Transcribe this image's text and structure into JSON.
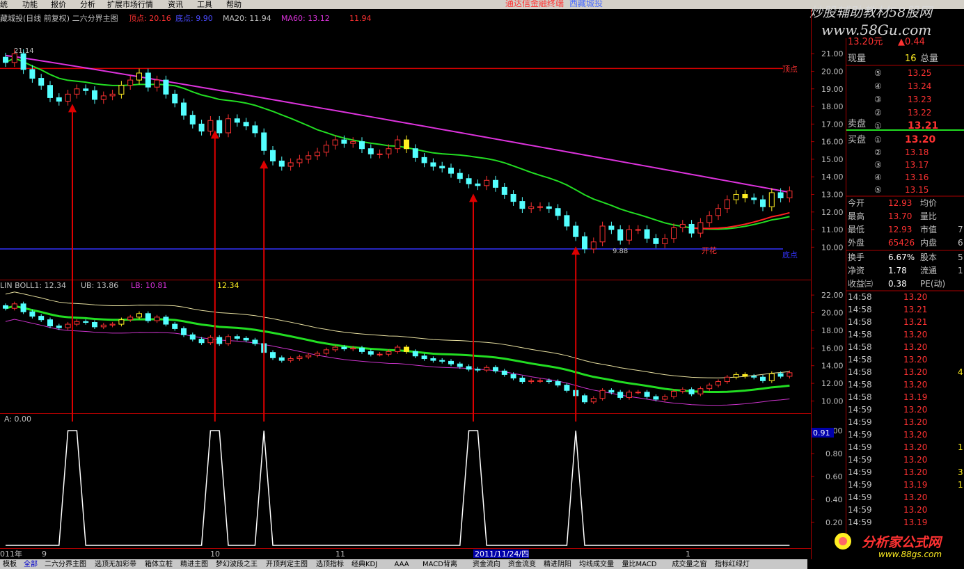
{
  "menu": [
    "统",
    "功能",
    "报价",
    "分析",
    "扩展市场行情",
    "资讯",
    "工具",
    "帮助"
  ],
  "header_center": {
    "text1": "通达信金融终端",
    "text2": "西藏城投"
  },
  "watermark": {
    "line1": "炒股辅助教材58股网",
    "line2": "www.58Gu.com",
    "bottom1": "分析家公式网",
    "bottom2": "www.88gs.com"
  },
  "main_legend": {
    "name": "藏城投(日线 前复权) 二六分界主图",
    "top_label": "顶点: 20.16",
    "bottom_label": "底点: 9.90",
    "ma20": "MA20: 11.94",
    "ma60": "MA60: 13.12",
    "extra": "11.94"
  },
  "main_chart_labels": {
    "top": "顶点",
    "bottom": "底点",
    "open_flower": "开花",
    "high_note": "21.14",
    "low_note": "9.88"
  },
  "boll_legend": {
    "name": "LIN BOLL1: 12.34",
    "ub": "UB: 13.86",
    "lb": "LB: 10.81",
    "extra": "12.34"
  },
  "ind_legend": {
    "a": "A: 0.00"
  },
  "price_axis": [
    "21.00",
    "20.00",
    "19.00",
    "18.00",
    "17.00",
    "16.00",
    "15.00",
    "14.00",
    "13.00",
    "12.00",
    "11.00",
    "10.00"
  ],
  "boll_axis": [
    "22.00",
    "20.00",
    "18.00",
    "16.00",
    "14.00",
    "12.00",
    "10.00"
  ],
  "ind_axis": [
    "1.00",
    "0.80",
    "0.60",
    "0.40",
    "0.20"
  ],
  "ind_current": "0.91",
  "date_axis": {
    "y2011": "011年",
    "m9": "9",
    "m10": "10",
    "m11": "11",
    "m12": "1",
    "cursor": "2011/11/24/四"
  },
  "quote": {
    "last": "13.20元",
    "change": "▲0.44",
    "now_vol_label": "现量",
    "now_vol": "16",
    "total_label": "总量",
    "sell": [
      {
        "n": "⑤",
        "p": "13.25"
      },
      {
        "n": "④",
        "p": "13.24"
      },
      {
        "n": "③",
        "p": "13.23"
      },
      {
        "n": "②",
        "p": "13.22"
      },
      {
        "n": "①",
        "p": "13.21"
      }
    ],
    "sell_label": "卖盘",
    "buy_label": "买盘",
    "buy": [
      {
        "n": "①",
        "p": "13.20"
      },
      {
        "n": "②",
        "p": "13.18"
      },
      {
        "n": "③",
        "p": "13.17"
      },
      {
        "n": "④",
        "p": "13.16"
      },
      {
        "n": "⑤",
        "p": "13.15"
      }
    ],
    "stats": [
      {
        "l1": "今开",
        "v1": "12.93",
        "l2": "均价",
        "v2": ""
      },
      {
        "l1": "最高",
        "v1": "13.70",
        "l2": "量比",
        "v2": ""
      },
      {
        "l1": "最低",
        "v1": "12.93",
        "l2": "市值",
        "v2": "7"
      },
      {
        "l1": "外盘",
        "v1": "65426",
        "l2": "内盘",
        "v2": "6"
      }
    ],
    "stats2": [
      {
        "l1": "换手",
        "v1": "6.67%",
        "l2": "股本",
        "v2": "5"
      },
      {
        "l1": "净资",
        "v1": "1.78",
        "l2": "流通",
        "v2": "1"
      },
      {
        "l1": "收益㈢",
        "v1": "0.38",
        "l2": "PE(动)",
        "v2": ""
      }
    ]
  },
  "ticks": [
    {
      "t": "14:58",
      "p": "13.20",
      "v": ""
    },
    {
      "t": "14:58",
      "p": "13.21",
      "v": ""
    },
    {
      "t": "14:58",
      "p": "13.21",
      "v": ""
    },
    {
      "t": "14:58",
      "p": "13.20",
      "v": ""
    },
    {
      "t": "14:58",
      "p": "13.20",
      "v": ""
    },
    {
      "t": "14:58",
      "p": "13.20",
      "v": ""
    },
    {
      "t": "14:58",
      "p": "13.20",
      "v": "4"
    },
    {
      "t": "14:58",
      "p": "13.20",
      "v": ""
    },
    {
      "t": "14:58",
      "p": "13.19",
      "v": ""
    },
    {
      "t": "14:59",
      "p": "13.20",
      "v": ""
    },
    {
      "t": "14:59",
      "p": "13.20",
      "v": ""
    },
    {
      "t": "14:59",
      "p": "13.20",
      "v": ""
    },
    {
      "t": "14:59",
      "p": "13.20",
      "v": "1"
    },
    {
      "t": "14:59",
      "p": "13.20",
      "v": ""
    },
    {
      "t": "14:59",
      "p": "13.20",
      "v": "3"
    },
    {
      "t": "14:59",
      "p": "13.19",
      "v": "1"
    },
    {
      "t": "14:59",
      "p": "13.20",
      "v": ""
    },
    {
      "t": "14:59",
      "p": "13.20",
      "v": ""
    },
    {
      "t": "14:59",
      "p": "13.19",
      "v": ""
    }
  ],
  "tabs": [
    "模板",
    "全部",
    "二六分界主图",
    "选顶无加彩带",
    "箱体立桩",
    "精进主图",
    "梦幻波段之王",
    "开顶判定主图",
    "选顶指标",
    "经典KDJ",
    "AAA",
    "MACD背离",
    "资金流向",
    "资金流变",
    "精进阴阳",
    "均线成交量",
    "量比MACD",
    "成交量之窗",
    "指标红绿灯"
  ],
  "colors": {
    "up": "#ff3232",
    "down": "#54ffff",
    "ma20": "#22dd22",
    "ma60": "#dd33dd",
    "yellow": "#ffee22",
    "top_line": "#cc0000",
    "bottom_line": "#3333ff",
    "frame": "#aa0000"
  },
  "chart_data": {
    "type": "candlestick",
    "x": [
      "2011-08-25",
      "2011-08-26",
      "2011-08-29",
      "2011-08-30",
      "2011-08-31",
      "2011-09-01",
      "2011-09-02",
      "2011-09-05",
      "2011-09-06",
      "2011-09-07",
      "2011-09-08",
      "2011-09-09",
      "2011-09-13",
      "2011-09-14",
      "2011-09-15",
      "2011-09-16",
      "2011-09-19",
      "2011-09-20",
      "2011-09-21",
      "2011-09-22",
      "2011-09-23",
      "2011-09-26",
      "2011-09-27",
      "2011-09-28",
      "2011-09-29",
      "2011-09-30",
      "2011-10-10",
      "2011-10-11",
      "2011-10-12",
      "2011-10-13",
      "2011-10-14",
      "2011-10-17",
      "2011-10-18",
      "2011-10-19",
      "2011-10-20",
      "2011-10-21",
      "2011-10-24",
      "2011-10-25",
      "2011-10-26",
      "2011-10-27",
      "2011-10-28",
      "2011-10-31",
      "2011-11-01",
      "2011-11-02",
      "2011-11-03",
      "2011-11-04",
      "2011-11-07",
      "2011-11-08",
      "2011-11-09",
      "2011-11-10",
      "2011-11-11",
      "2011-11-14",
      "2011-11-15",
      "2011-11-16",
      "2011-11-17",
      "2011-11-18",
      "2011-11-21",
      "2011-11-22",
      "2011-11-23",
      "2011-11-24",
      "2011-11-25",
      "2011-11-28",
      "2011-11-29",
      "2011-11-30",
      "2011-12-01",
      "2011-12-02",
      "2011-12-05",
      "2011-12-06",
      "2011-12-07",
      "2011-12-08",
      "2011-12-09",
      "2011-12-12",
      "2011-12-13",
      "2011-12-14",
      "2011-12-15",
      "2011-12-16",
      "2011-12-19",
      "2011-12-20",
      "2011-12-21",
      "2011-12-22",
      "2011-12-23",
      "2011-12-26",
      "2011-12-27",
      "2011-12-28",
      "2011-12-29",
      "2011-12-30",
      "2012-01-04",
      "2012-01-05",
      "2012-01-06"
    ],
    "close": [
      20.5,
      21.0,
      20.1,
      19.6,
      19.2,
      18.5,
      18.3,
      18.7,
      19.0,
      18.9,
      18.4,
      18.6,
      18.7,
      19.2,
      19.5,
      19.9,
      19.1,
      19.5,
      18.7,
      18.2,
      17.5,
      17.0,
      16.6,
      17.2,
      16.5,
      17.3,
      17.1,
      16.9,
      16.5,
      15.5,
      14.9,
      14.6,
      14.8,
      15.0,
      15.2,
      15.4,
      15.8,
      16.1,
      15.9,
      16.0,
      15.6,
      15.3,
      15.3,
      15.6,
      16.1,
      15.6,
      15.1,
      14.8,
      14.6,
      14.5,
      14.2,
      13.9,
      13.6,
      13.5,
      13.8,
      13.4,
      13.0,
      12.6,
      12.2,
      12.3,
      12.3,
      12.2,
      11.8,
      11.2,
      10.6,
      9.9,
      10.3,
      11.2,
      11.0,
      10.4,
      11.0,
      11.0,
      10.5,
      10.2,
      10.5,
      11.1,
      11.3,
      10.8,
      11.4,
      11.8,
      12.2,
      12.7,
      13.0,
      12.8,
      12.7,
      12.3,
      13.1,
      12.8,
      13.2
    ],
    "ylim": [
      9.5,
      21.6
    ],
    "boll_ylim": [
      8.7,
      22.8
    ],
    "signal_A": [
      0,
      0,
      0,
      0,
      0,
      0,
      0,
      1,
      1,
      0,
      0,
      0,
      0,
      0,
      0,
      0,
      0,
      0,
      0,
      0,
      0,
      0,
      0,
      1,
      1,
      0,
      0,
      0,
      0,
      1,
      0,
      0,
      0,
      0,
      0,
      0,
      0,
      0,
      0,
      0,
      0,
      0,
      0,
      0,
      0,
      0,
      0,
      0,
      0,
      0,
      0,
      0,
      1,
      1,
      0,
      0,
      0,
      0,
      0,
      0,
      0,
      0,
      0,
      0,
      1,
      0,
      0,
      0,
      0,
      0,
      0,
      0,
      0,
      0,
      0,
      0,
      0,
      0,
      0,
      0,
      0,
      0,
      0,
      0,
      0,
      0,
      0,
      0,
      0
    ],
    "signal_ylim": [
      0,
      1.08
    ]
  }
}
